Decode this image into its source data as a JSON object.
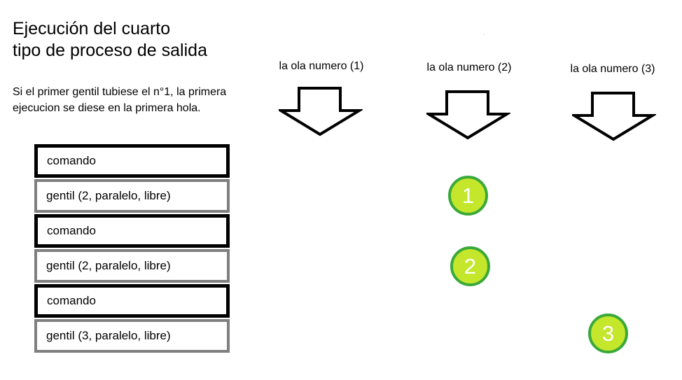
{
  "title": {
    "line1": "Ejecución del cuarto",
    "line2": "tipo de proceso de salida"
  },
  "description": {
    "line1": "Si el primer gentil tubiese el n°1, la primera",
    "line2": "ejecucion se diese en la primera hola."
  },
  "blocks": [
    {
      "type": "comando",
      "label": "comando"
    },
    {
      "type": "gentil",
      "label": "gentil (2, paralelo, libre)"
    },
    {
      "type": "comando",
      "label": "comando"
    },
    {
      "type": "gentil",
      "label": "gentil (2, paralelo, libre)"
    },
    {
      "type": "comando",
      "label": "comando"
    },
    {
      "type": "gentil",
      "label": "gentil (3, paralelo, libre)"
    }
  ],
  "waves": [
    {
      "label": "la ola numero (1)",
      "icon": "arrow-down-outline-icon"
    },
    {
      "label": "la ola numero (2)",
      "icon": "arrow-down-outline-icon"
    },
    {
      "label": "la ola numero (3)",
      "icon": "arrow-down-outline-icon"
    }
  ],
  "markers": [
    {
      "number": "1",
      "wave": 2
    },
    {
      "number": "2",
      "wave": 2
    },
    {
      "number": "3",
      "wave": 3
    }
  ],
  "colors": {
    "marker_fill": "#c4e62b",
    "marker_border": "#3aa93a",
    "marker_text": "#ffffff",
    "comando_border": "#000000",
    "gentil_border": "#7f7f7f"
  }
}
